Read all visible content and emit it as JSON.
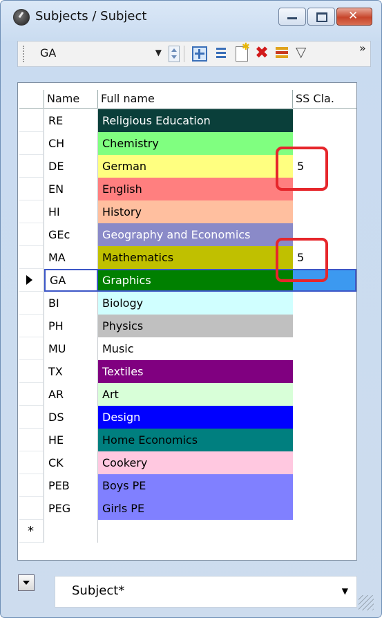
{
  "window": {
    "title": "Subjects / Subject"
  },
  "toolbar": {
    "selected_value": "GA",
    "icons": [
      "grid-icon",
      "list-icon",
      "new-record-icon",
      "delete-icon",
      "report-icon",
      "filter-icon",
      "more-icon"
    ]
  },
  "columns": {
    "name": "Name",
    "full_name": "Full name",
    "ss_class": "SS Cla."
  },
  "rows": [
    {
      "name": "RE",
      "full_name": "Religious Education",
      "ss": "",
      "bg": "#0a3f3a",
      "fg": "#ffffff"
    },
    {
      "name": "CH",
      "full_name": "Chemistry",
      "ss": "",
      "bg": "#80ff80",
      "fg": "#000000"
    },
    {
      "name": "DE",
      "full_name": "German",
      "ss": "5",
      "bg": "#ffff80",
      "fg": "#000000"
    },
    {
      "name": "EN",
      "full_name": "English",
      "ss": "",
      "bg": "#ff7f7f",
      "fg": "#000000"
    },
    {
      "name": "HI",
      "full_name": "History",
      "ss": "",
      "bg": "#ffbf9f",
      "fg": "#000000"
    },
    {
      "name": "GEc",
      "full_name": "Geography and Economics",
      "ss": "",
      "bg": "#8a8ac8",
      "fg": "#ffffff"
    },
    {
      "name": "MA",
      "full_name": "Mathematics",
      "ss": "5",
      "bg": "#c0c000",
      "fg": "#000000"
    },
    {
      "name": "GA",
      "full_name": "Graphics",
      "ss": "",
      "bg": "#008000",
      "fg": "#ffffff",
      "current": true
    },
    {
      "name": "BI",
      "full_name": "Biology",
      "ss": "",
      "bg": "#d0ffff",
      "fg": "#000000"
    },
    {
      "name": "PH",
      "full_name": "Physics",
      "ss": "",
      "bg": "#c0c0c0",
      "fg": "#000000"
    },
    {
      "name": "MU",
      "full_name": "Music",
      "ss": "",
      "bg": "#ffffff",
      "fg": "#000000"
    },
    {
      "name": "TX",
      "full_name": "Textiles",
      "ss": "",
      "bg": "#800080",
      "fg": "#ffffff"
    },
    {
      "name": "AR",
      "full_name": "Art",
      "ss": "",
      "bg": "#d8ffd8",
      "fg": "#000000"
    },
    {
      "name": "DS",
      "full_name": "Design",
      "ss": "",
      "bg": "#0000ff",
      "fg": "#ffffff"
    },
    {
      "name": "HE",
      "full_name": "Home Economics",
      "ss": "",
      "bg": "#007f7f",
      "fg": "#000000"
    },
    {
      "name": "CK",
      "full_name": "Cookery",
      "ss": "",
      "bg": "#ffc8e0",
      "fg": "#000000"
    },
    {
      "name": "PEB",
      "full_name": "Boys PE",
      "ss": "",
      "bg": "#8080ff",
      "fg": "#000000"
    },
    {
      "name": "PEG",
      "full_name": "Girls PE",
      "ss": "",
      "bg": "#8080ff",
      "fg": "#000000"
    }
  ],
  "new_row_marker": "*",
  "footer": {
    "view_name": "Subject*"
  },
  "colors": {
    "highlight_box": "#e6262b",
    "selection_border": "#3d57c7",
    "selection_fill": "#3c99f0"
  }
}
